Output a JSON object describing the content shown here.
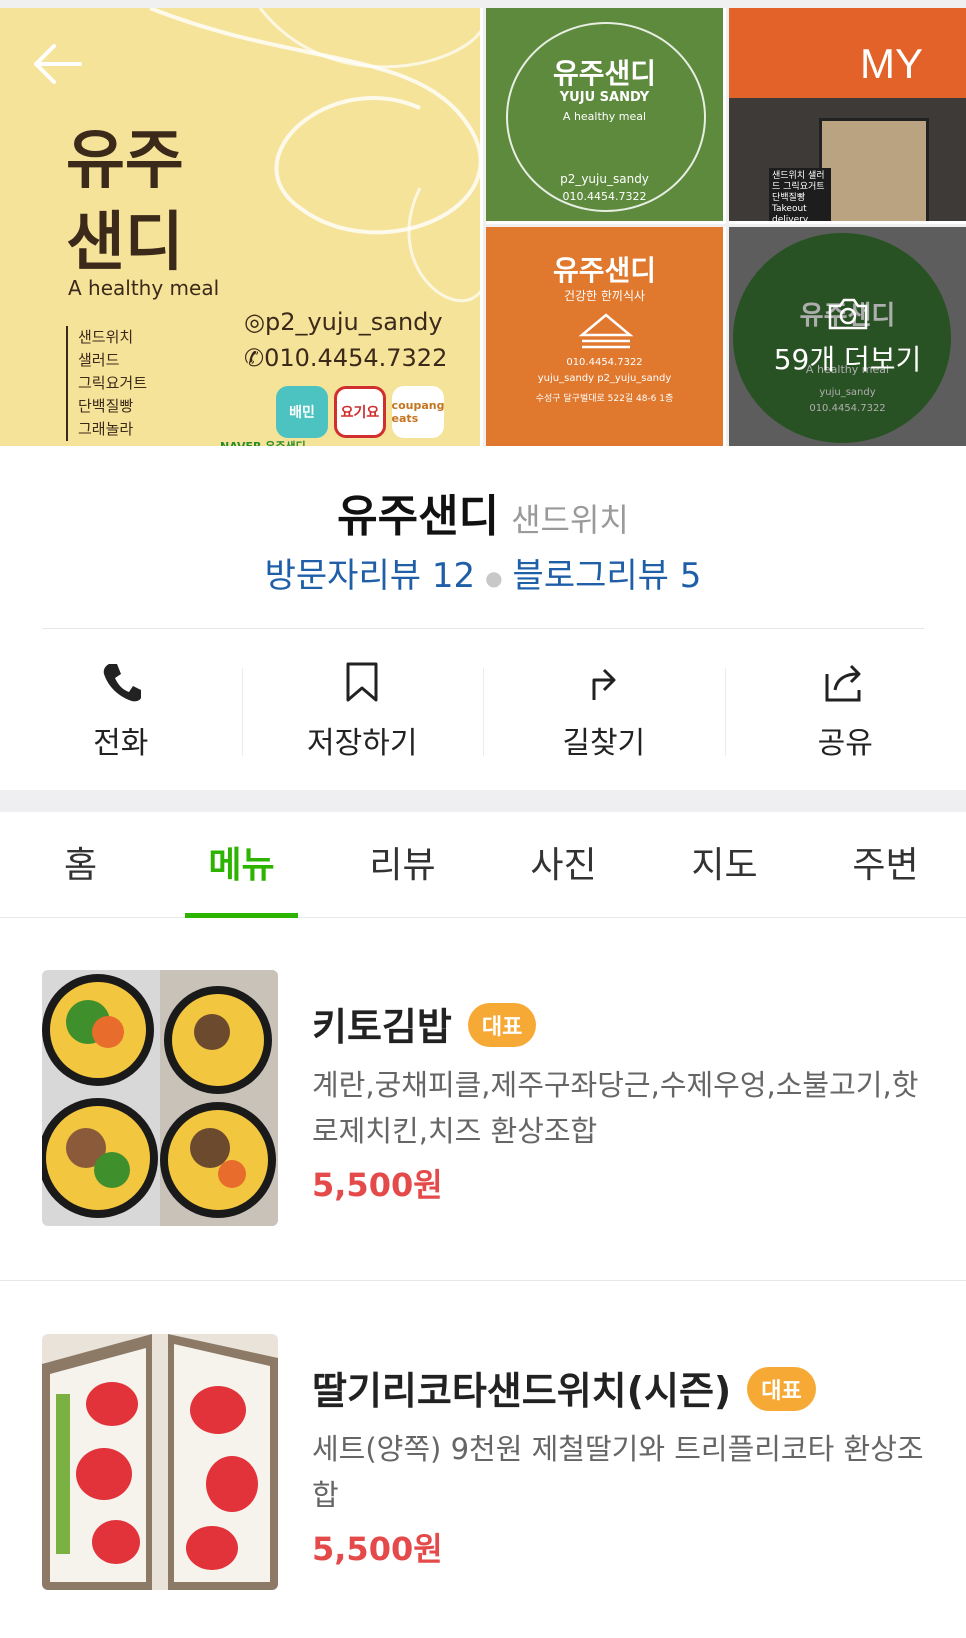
{
  "gallery": {
    "main_title_line1": "유주",
    "main_title_line2": "샌디",
    "main_tagline": "A healthy meal",
    "main_list": [
      "샌드위치",
      "샐러드",
      "그릭요거트",
      "단백질빵",
      "그래놀라"
    ],
    "main_instagram": "p2_yuju_sandy",
    "main_phone": "010.4454.7322",
    "main_apps": [
      "배민",
      "요기요",
      "coupang eats"
    ],
    "main_naver": "NAVER  유주샌디",
    "tile1_logo": "유주샌디",
    "tile1_sub": "YUJU SANDY",
    "tile1_tagline": "A healthy meal",
    "tile1_insta": "p2_yuju_sandy",
    "tile1_phone": "010.4454.7322",
    "tile2_sign": "샌드위치 샐러드 그릭요거트 단백질빵 Takeout delivery",
    "tile3_logo": "유주샌디",
    "tile3_sub": "건강한 한끼식사",
    "tile3_phone": "010.4454.7322",
    "tile3_sns": "yuju_sandy   p2_yuju_sandy",
    "tile3_addr": "수성구 달구벌대로 522길 48-6 1층",
    "tile4_logo": "유주샌디",
    "tile4_tagline": "A healthy meal",
    "tile4_insta": "yuju_sandy",
    "tile4_phone": "010.4454.7322",
    "more_photos": "59개 더보기",
    "my_label": "MY"
  },
  "place": {
    "name": "유주샌디",
    "category": "샌드위치",
    "visitor_review": "방문자리뷰 12",
    "blog_review": "블로그리뷰 5"
  },
  "actions": [
    {
      "label": "전화",
      "icon": "phone-icon"
    },
    {
      "label": "저장하기",
      "icon": "bookmark-icon"
    },
    {
      "label": "길찾기",
      "icon": "directions-icon"
    },
    {
      "label": "공유",
      "icon": "share-icon"
    }
  ],
  "tabs": [
    "홈",
    "메뉴",
    "리뷰",
    "사진",
    "지도",
    "주변"
  ],
  "active_tab": "메뉴",
  "colors": {
    "accent_green": "#2db400",
    "price_red": "#e54a4a",
    "badge_orange": "#f7a935",
    "review_blue": "#1f5fa8"
  },
  "menu": [
    {
      "name": "키토김밥",
      "badge": "대표",
      "desc": "계란,궁채피클,제주구좌당근,수제우엉,소불고기,핫로제치킨,치즈 환상조합",
      "price": "5,500원"
    },
    {
      "name": "딸기리코타샌드위치(시즌)",
      "badge": "대표",
      "desc": "세트(양쪽) 9천원 제철딸기와 트리플리코타 환상조합",
      "price": "5,500원"
    }
  ]
}
